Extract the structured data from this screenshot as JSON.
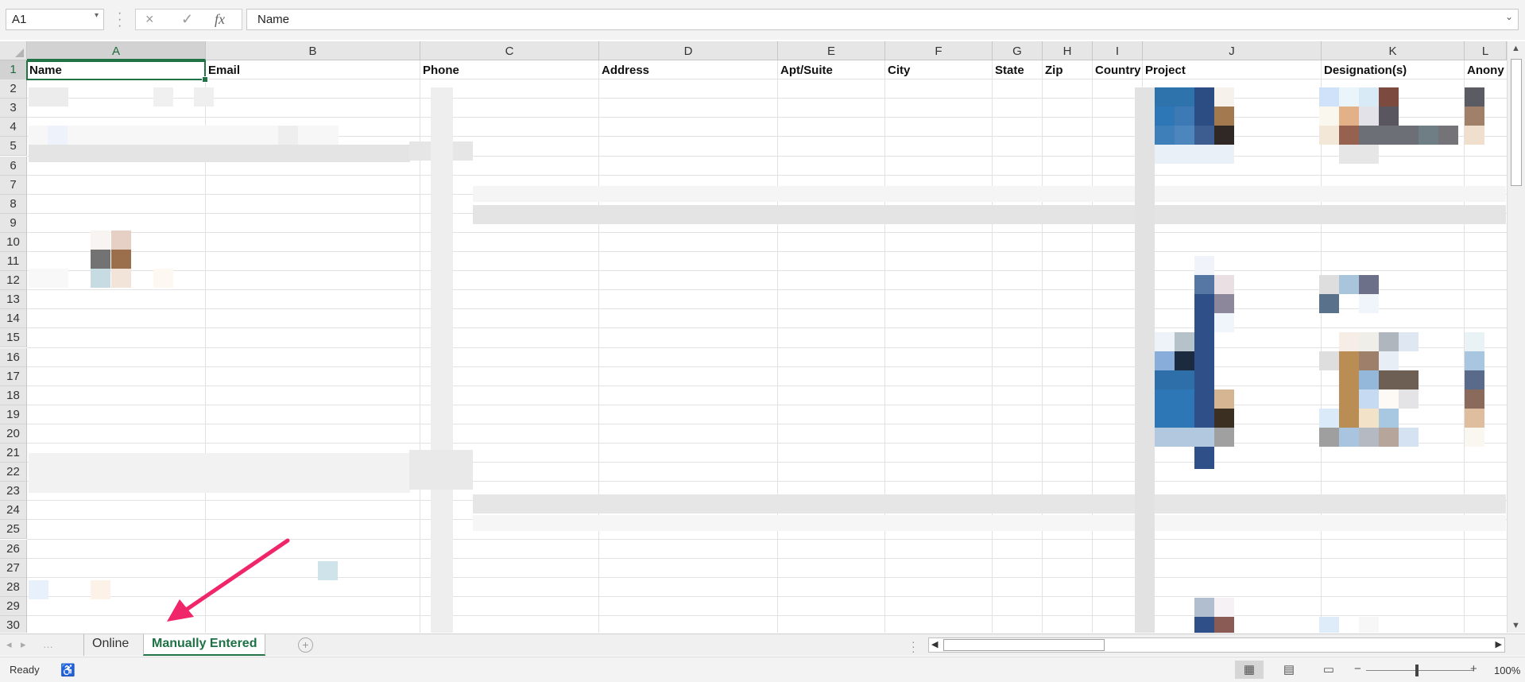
{
  "formula_bar": {
    "name_box": "A1",
    "formula": "Name",
    "cancel_icon": "×",
    "enter_icon": "✓",
    "fx_label": "fx"
  },
  "columns": [
    "A",
    "B",
    "C",
    "D",
    "E",
    "F",
    "G",
    "H",
    "I",
    "J",
    "K",
    "L"
  ],
  "selected_column": "A",
  "row_numbers": [
    "1",
    "2",
    "3",
    "4",
    "5",
    "6",
    "7",
    "8",
    "9",
    "10",
    "11",
    "12",
    "13",
    "14",
    "15",
    "16",
    "17",
    "18",
    "19",
    "20",
    "21",
    "22",
    "23",
    "24",
    "25",
    "26",
    "27",
    "28",
    "29",
    "30"
  ],
  "header_row": {
    "A": "Name",
    "B": "Email",
    "C": "Phone",
    "D": "Address",
    "E": "Apt/Suite",
    "F": "City",
    "G": "State",
    "H": "Zip",
    "I": "Country",
    "J": "Project",
    "K": "Designation(s)",
    "L": "Anony"
  },
  "sheet_tabs": [
    {
      "label": "Online",
      "active": false
    },
    {
      "label": "Manually Entered",
      "active": true
    }
  ],
  "status_bar": {
    "status": "Ready",
    "zoom": "100%"
  },
  "colors": {
    "excel_green": "#217346",
    "annotation_arrow": "#f0266b"
  }
}
